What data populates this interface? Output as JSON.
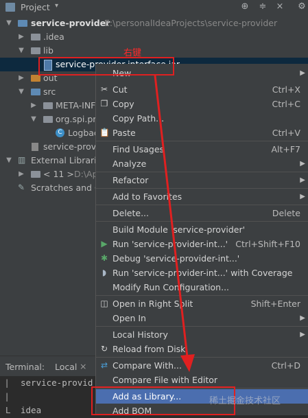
{
  "toolbar": {
    "title": "Project",
    "icons": [
      "project-icon",
      "globe-icon",
      "collapse-icon",
      "close-icon",
      "gear-icon"
    ]
  },
  "tree": {
    "project": {
      "name": "service-provider",
      "path": "E:\\personalIdeaProjects\\service-provider"
    },
    "idea": ".idea",
    "lib": "lib",
    "jar": "service-provider-interface.jar",
    "out": "out",
    "src": "src",
    "metainf": "META-INF",
    "pkg": "org.spi.pr",
    "logback": "Logbac",
    "iml": "service-provi",
    "ext": "External Librarie",
    "jdk": "< 11 >",
    "jdk_path": "D:\\Ap",
    "scratches": "Scratches and C"
  },
  "annotation": "右键",
  "menu": {
    "new": "New",
    "cut": {
      "label": "Cut",
      "shortcut": "Ctrl+X"
    },
    "copy": {
      "label": "Copy",
      "shortcut": "Ctrl+C"
    },
    "copy_path": "Copy Path...",
    "paste": {
      "label": "Paste",
      "shortcut": "Ctrl+V"
    },
    "find_usages": {
      "label": "Find Usages",
      "shortcut": "Alt+F7"
    },
    "analyze": "Analyze",
    "refactor": "Refactor",
    "add_fav": "Add to Favorites",
    "delete": {
      "label": "Delete...",
      "shortcut": "Delete"
    },
    "build": "Build Module 'service-provider'",
    "run": {
      "label": "Run 'service-provider-int...'",
      "shortcut": "Ctrl+Shift+F10"
    },
    "debug": "Debug 'service-provider-int...'",
    "coverage": "Run 'service-provider-int...' with Coverage",
    "modify": "Modify Run Configuration...",
    "open_right": {
      "label": "Open in Right Split",
      "shortcut": "Shift+Enter"
    },
    "open_in": "Open In",
    "local_history": "Local History",
    "reload": "Reload from Disk",
    "compare_with": {
      "label": "Compare With...",
      "shortcut": "Ctrl+D"
    },
    "compare_editor": "Compare File with Editor",
    "add_library": "Add as Library...",
    "add_bom": "Add BOM"
  },
  "terminal": {
    "label": "Terminal:",
    "tab": "Local",
    "line1": "service-provid",
    "line2": "idea"
  },
  "watermark": "稀土掘金技术社区"
}
